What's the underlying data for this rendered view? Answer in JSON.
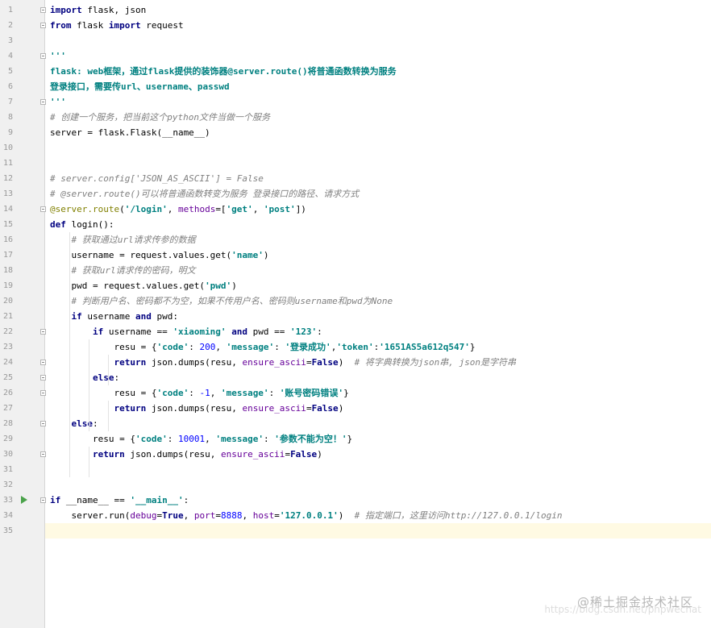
{
  "editor": {
    "line_numbers": [
      "1",
      "2",
      "3",
      "4",
      "5",
      "6",
      "7",
      "8",
      "9",
      "10",
      "11",
      "12",
      "13",
      "14",
      "15",
      "16",
      "17",
      "18",
      "19",
      "20",
      "21",
      "22",
      "23",
      "24",
      "25",
      "26",
      "27",
      "28",
      "29",
      "30",
      "31",
      "32",
      "33",
      "34",
      "35"
    ],
    "lines": [
      [
        {
          "t": "import",
          "c": "kw"
        },
        {
          "t": " flask, json"
        }
      ],
      [
        {
          "t": "from",
          "c": "kw"
        },
        {
          "t": " flask "
        },
        {
          "t": "import",
          "c": "kw"
        },
        {
          "t": " request"
        }
      ],
      [],
      [
        {
          "t": "'''",
          "c": "str"
        }
      ],
      [
        {
          "t": "flask: web框架，通过flask提供的装饰器@server.route()将普通函数转换为服务",
          "c": "str"
        }
      ],
      [
        {
          "t": "登录接口，需要传url、username、passwd",
          "c": "str"
        }
      ],
      [
        {
          "t": "'''",
          "c": "str"
        }
      ],
      [
        {
          "t": "# 创建一个服务，把当前这个python文件当做一个服务",
          "c": "cmt"
        }
      ],
      [
        {
          "t": "server = flask.Flask(__name__)"
        }
      ],
      [],
      [],
      [
        {
          "t": "# server.config['JSON_AS_ASCII'] = False",
          "c": "cmt"
        }
      ],
      [
        {
          "t": "# @server.route()可以将普通函数转变为服务 登录接口的路径、请求方式",
          "c": "cmt"
        }
      ],
      [
        {
          "t": "@server.route",
          "c": "dec"
        },
        {
          "t": "("
        },
        {
          "t": "'/login'",
          "c": "str"
        },
        {
          "t": ", "
        },
        {
          "t": "methods",
          "c": "kwarg"
        },
        {
          "t": "=["
        },
        {
          "t": "'get'",
          "c": "str"
        },
        {
          "t": ", "
        },
        {
          "t": "'post'",
          "c": "str"
        },
        {
          "t": "])"
        }
      ],
      [
        {
          "t": "def",
          "c": "kw"
        },
        {
          "t": " login():"
        }
      ],
      [
        {
          "t": "    "
        },
        {
          "t": "# 获取通过url请求传参的数据",
          "c": "cmt"
        }
      ],
      [
        {
          "t": "    username = request.values.get("
        },
        {
          "t": "'name'",
          "c": "str"
        },
        {
          "t": ")"
        }
      ],
      [
        {
          "t": "    "
        },
        {
          "t": "# 获取url请求传的密码，明文",
          "c": "cmt"
        }
      ],
      [
        {
          "t": "    pwd = request.values.get("
        },
        {
          "t": "'pwd'",
          "c": "str"
        },
        {
          "t": ")"
        }
      ],
      [
        {
          "t": "    "
        },
        {
          "t": "# 判断用户名、密码都不为空，如果不传用户名、密码则username和pwd为None",
          "c": "cmt"
        }
      ],
      [
        {
          "t": "    "
        },
        {
          "t": "if",
          "c": "kw"
        },
        {
          "t": " username "
        },
        {
          "t": "and",
          "c": "kw"
        },
        {
          "t": " pwd:"
        }
      ],
      [
        {
          "t": "        "
        },
        {
          "t": "if",
          "c": "kw"
        },
        {
          "t": " username == "
        },
        {
          "t": "'xiaoming'",
          "c": "str"
        },
        {
          "t": " "
        },
        {
          "t": "and",
          "c": "kw"
        },
        {
          "t": " pwd == "
        },
        {
          "t": "'123'",
          "c": "str"
        },
        {
          "t": ":"
        }
      ],
      [
        {
          "t": "            resu = {"
        },
        {
          "t": "'code'",
          "c": "str"
        },
        {
          "t": ": "
        },
        {
          "t": "200",
          "c": "num"
        },
        {
          "t": ", "
        },
        {
          "t": "'message'",
          "c": "str"
        },
        {
          "t": ": "
        },
        {
          "t": "'登录成功'",
          "c": "str"
        },
        {
          "t": ","
        },
        {
          "t": "'token'",
          "c": "str"
        },
        {
          "t": ":"
        },
        {
          "t": "'1651AS5a612q547'",
          "c": "str"
        },
        {
          "t": "}"
        }
      ],
      [
        {
          "t": "            "
        },
        {
          "t": "return",
          "c": "kw"
        },
        {
          "t": " json.dumps(resu, "
        },
        {
          "t": "ensure_ascii",
          "c": "kwarg"
        },
        {
          "t": "="
        },
        {
          "t": "False",
          "c": "kw"
        },
        {
          "t": ")  "
        },
        {
          "t": "# 将字典转换为json串, json是字符串",
          "c": "cmt"
        }
      ],
      [
        {
          "t": "        "
        },
        {
          "t": "else",
          "c": "kw"
        },
        {
          "t": ":"
        }
      ],
      [
        {
          "t": "            resu = {"
        },
        {
          "t": "'code'",
          "c": "str"
        },
        {
          "t": ": "
        },
        {
          "t": "-1",
          "c": "num"
        },
        {
          "t": ", "
        },
        {
          "t": "'message'",
          "c": "str"
        },
        {
          "t": ": "
        },
        {
          "t": "'账号密码错误'",
          "c": "str"
        },
        {
          "t": "}"
        }
      ],
      [
        {
          "t": "            "
        },
        {
          "t": "return",
          "c": "kw"
        },
        {
          "t": " json.dumps(resu, "
        },
        {
          "t": "ensure_ascii",
          "c": "kwarg"
        },
        {
          "t": "="
        },
        {
          "t": "False",
          "c": "kw"
        },
        {
          "t": ")"
        }
      ],
      [
        {
          "t": "    "
        },
        {
          "t": "else",
          "c": "kw"
        },
        {
          "t": ":"
        }
      ],
      [
        {
          "t": "        resu = {"
        },
        {
          "t": "'code'",
          "c": "str"
        },
        {
          "t": ": "
        },
        {
          "t": "10001",
          "c": "num"
        },
        {
          "t": ", "
        },
        {
          "t": "'message'",
          "c": "str"
        },
        {
          "t": ": "
        },
        {
          "t": "'参数不能为空！'",
          "c": "str"
        },
        {
          "t": "}"
        }
      ],
      [
        {
          "t": "        "
        },
        {
          "t": "return",
          "c": "kw"
        },
        {
          "t": " json.dumps(resu, "
        },
        {
          "t": "ensure_ascii",
          "c": "kwarg"
        },
        {
          "t": "="
        },
        {
          "t": "False",
          "c": "kw"
        },
        {
          "t": ")"
        }
      ],
      [],
      [],
      [
        {
          "t": "if",
          "c": "kw"
        },
        {
          "t": " __name__ == "
        },
        {
          "t": "'__main__'",
          "c": "str"
        },
        {
          "t": ":"
        }
      ],
      [
        {
          "t": "    server.run("
        },
        {
          "t": "debug",
          "c": "kwarg"
        },
        {
          "t": "="
        },
        {
          "t": "True",
          "c": "kw"
        },
        {
          "t": ", "
        },
        {
          "t": "port",
          "c": "kwarg"
        },
        {
          "t": "="
        },
        {
          "t": "8888",
          "c": "num"
        },
        {
          "t": ", "
        },
        {
          "t": "host",
          "c": "kwarg"
        },
        {
          "t": "="
        },
        {
          "t": "'127.0.0.1'",
          "c": "str"
        },
        {
          "t": ")  "
        },
        {
          "t": "# 指定端口，这里访问http://127.0.0.1/login",
          "c": "cmt"
        }
      ],
      []
    ],
    "current_line": "35",
    "run_marker_line": "33",
    "fold_lines": [
      "1",
      "2",
      "4",
      "7",
      "14",
      "22",
      "24",
      "25",
      "26",
      "28",
      "30",
      "33"
    ]
  },
  "watermark": {
    "text": "@稀土掘金技术社区",
    "url_text": "https://blog.csdn.net/phpwechat"
  },
  "colors": {
    "keyword": "#000080",
    "string": "#008080",
    "comment": "#808080",
    "number": "#0000ff",
    "decorator": "#808000",
    "kwarg": "#660099",
    "gutter_bg": "#f0f0f0",
    "current_line_bg": "#fffae3"
  },
  "icons": {
    "run": "run-icon",
    "fold": "fold-marker-icon"
  }
}
